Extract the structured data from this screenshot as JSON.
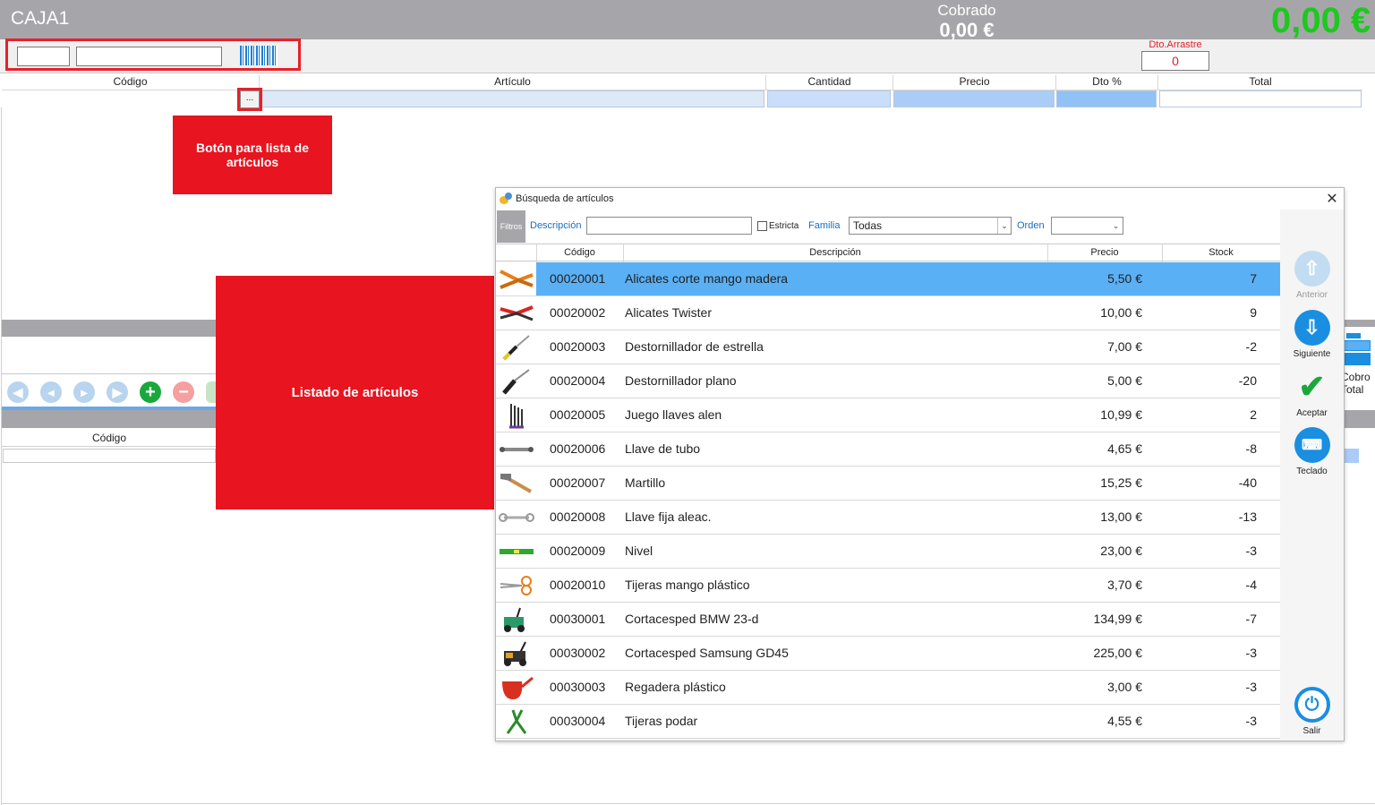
{
  "header": {
    "pos_title": "CAJA1",
    "cobrado_label": "Cobrado",
    "cobrado_value": "0,00 €",
    "total_display": "0,00 €"
  },
  "toolbar": {
    "dto_arrastre_label": "Dto.Arrastre",
    "dto_arrastre_value": "0"
  },
  "main_grid": {
    "columns": [
      "Código",
      "Artículo",
      "Cantidad",
      "Precio",
      "Dto %",
      "Total"
    ],
    "ellipsis_button": "..."
  },
  "annotations": {
    "callout_button": "Botón para lista de artículos",
    "callout_list": "Listado de artículos"
  },
  "lower_panel": {
    "codigo_header": "Código",
    "nav_icons": [
      "first-icon",
      "prev-icon",
      "next-icon",
      "last-icon",
      "add-icon",
      "remove-icon"
    ]
  },
  "right_fragment": {
    "cobro_label_line1": "Cobro",
    "cobro_label_line2": "Total"
  },
  "dialog": {
    "title": "Búsqueda de artículos",
    "close": "✕",
    "filters": {
      "tab_label": "Filtros",
      "descripcion_label": "Descripción",
      "descripcion_value": "",
      "estricta_label": "Estricta",
      "familia_label": "Familia",
      "familia_value": "Todas",
      "orden_label": "Orden",
      "orden_value": ""
    },
    "table": {
      "columns": [
        "Código",
        "Descripción",
        "Precio",
        "Stock"
      ],
      "rows": [
        {
          "code": "00020001",
          "desc": "Alicates corte mango madera",
          "price": "5,50 €",
          "stock": "7",
          "icon": "pliers-icon",
          "selected": true
        },
        {
          "code": "00020002",
          "desc": "Alicates Twister",
          "price": "10,00 €",
          "stock": "9",
          "icon": "pliers-red-icon",
          "selected": false
        },
        {
          "code": "00020003",
          "desc": "Destornillador de estrella",
          "price": "7,00 €",
          "stock": "-2",
          "icon": "screwdriver-icon",
          "selected": false
        },
        {
          "code": "00020004",
          "desc": "Destornillador plano",
          "price": "5,00 €",
          "stock": "-20",
          "icon": "screwdriver-flat-icon",
          "selected": false
        },
        {
          "code": "00020005",
          "desc": "Juego llaves alen",
          "price": "10,99 €",
          "stock": "2",
          "icon": "allen-keys-icon",
          "selected": false
        },
        {
          "code": "00020006",
          "desc": "Llave de tubo",
          "price": "4,65 €",
          "stock": "-8",
          "icon": "tube-wrench-icon",
          "selected": false
        },
        {
          "code": "00020007",
          "desc": "Martillo",
          "price": "15,25 €",
          "stock": "-40",
          "icon": "hammer-icon",
          "selected": false
        },
        {
          "code": "00020008",
          "desc": "Llave fija aleac.",
          "price": "13,00 €",
          "stock": "-13",
          "icon": "wrench-icon",
          "selected": false
        },
        {
          "code": "00020009",
          "desc": "Nivel",
          "price": "23,00 €",
          "stock": "-3",
          "icon": "level-icon",
          "selected": false
        },
        {
          "code": "00020010",
          "desc": "Tijeras mango plástico",
          "price": "3,70 €",
          "stock": "-4",
          "icon": "scissors-icon",
          "selected": false
        },
        {
          "code": "00030001",
          "desc": "Cortacesped BMW 23-d",
          "price": "134,99 €",
          "stock": "-7",
          "icon": "lawnmower-green-icon",
          "selected": false
        },
        {
          "code": "00030002",
          "desc": "Cortacesped Samsung GD45",
          "price": "225,00 €",
          "stock": "-3",
          "icon": "lawnmower-icon",
          "selected": false
        },
        {
          "code": "00030003",
          "desc": "Regadera plástico",
          "price": "3,00 €",
          "stock": "-3",
          "icon": "watering-can-icon",
          "selected": false
        },
        {
          "code": "00030004",
          "desc": "Tijeras podar",
          "price": "4,55 €",
          "stock": "-3",
          "icon": "pruning-shears-icon",
          "selected": false
        }
      ]
    },
    "side_buttons": {
      "anterior": "Anterior",
      "siguiente": "Siguiente",
      "aceptar": "Aceptar",
      "teclado": "Teclado",
      "salir": "Salir"
    }
  },
  "colors": {
    "header_gray": "#a6a6aa",
    "total_green": "#1ec81e",
    "annotation_red": "#e8141f",
    "selection_blue": "#5ab0f5",
    "accent_blue": "#1a8ee0"
  }
}
